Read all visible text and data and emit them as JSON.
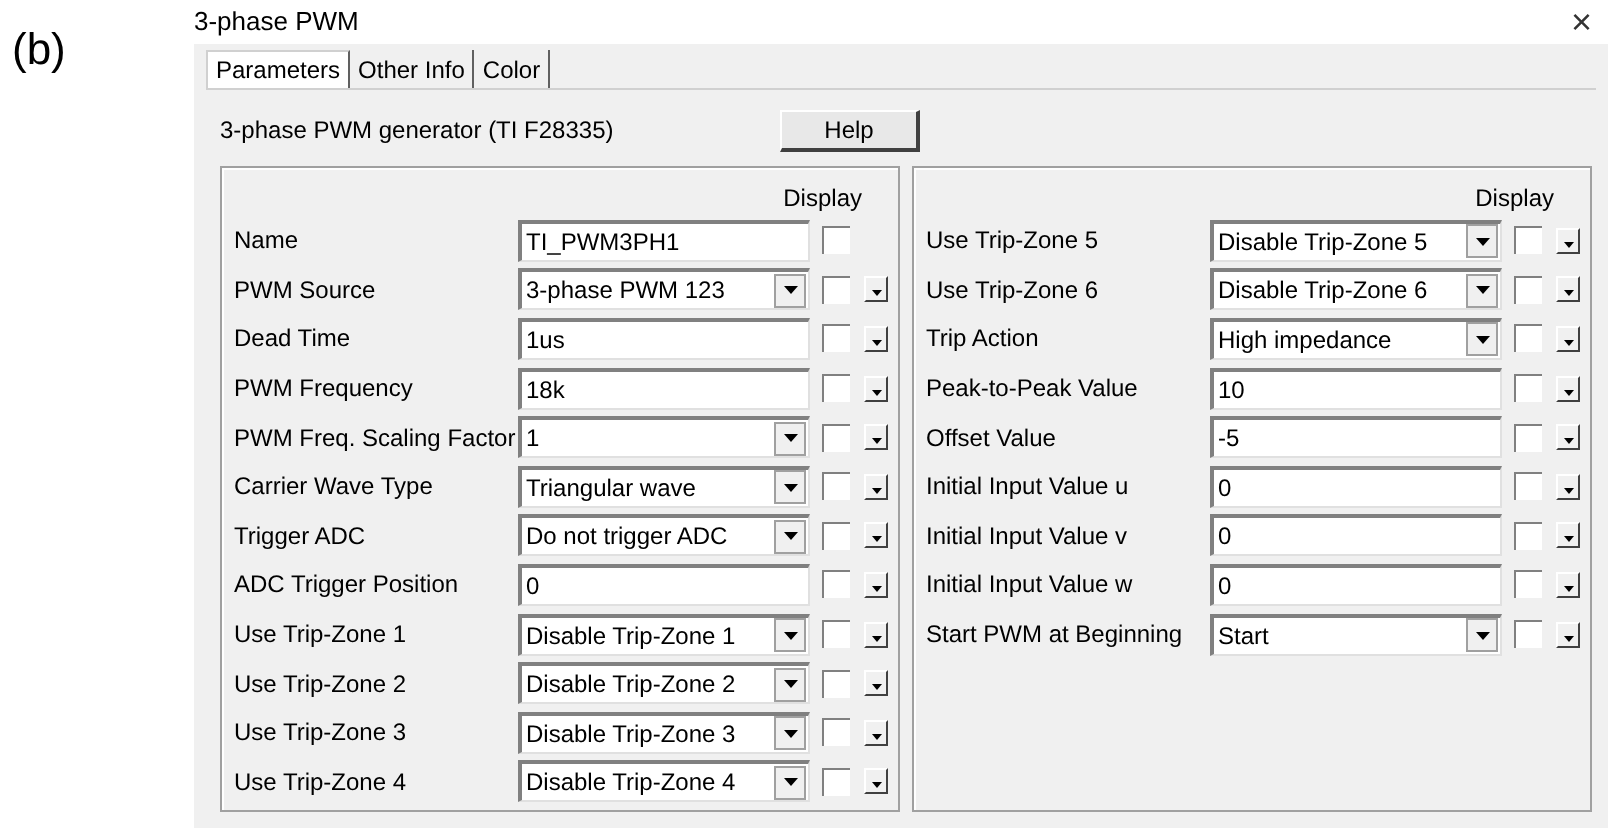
{
  "figure_label": "(b)",
  "window": {
    "title": "3-phase PWM",
    "close": "×"
  },
  "tabs": [
    {
      "label": "Parameters",
      "selected": true
    },
    {
      "label": "Other Info",
      "selected": false
    },
    {
      "label": "Color",
      "selected": false
    }
  ],
  "description": "3-phase PWM generator (TI F28335)",
  "help_button": "Help",
  "panels": [
    {
      "display_header": "Display",
      "rows": [
        {
          "label": "Name",
          "kind": "text",
          "value": "TI_PWM3PH1",
          "checked": false,
          "has_options_button": false
        },
        {
          "label": "PWM Source",
          "kind": "dropdown",
          "value": "3-phase PWM 123",
          "checked": false,
          "has_options_button": true
        },
        {
          "label": "Dead Time",
          "kind": "text",
          "value": "1us",
          "checked": false,
          "has_options_button": true
        },
        {
          "label": "PWM Frequency",
          "kind": "text",
          "value": "18k",
          "checked": false,
          "has_options_button": true
        },
        {
          "label": "PWM Freq. Scaling Factor",
          "kind": "dropdown",
          "value": "1",
          "checked": false,
          "has_options_button": true
        },
        {
          "label": "Carrier Wave Type",
          "kind": "dropdown",
          "value": "Triangular wave",
          "checked": false,
          "has_options_button": true
        },
        {
          "label": "Trigger ADC",
          "kind": "dropdown",
          "value": "Do not trigger ADC",
          "checked": false,
          "has_options_button": true
        },
        {
          "label": "ADC Trigger Position",
          "kind": "text",
          "value": "0",
          "checked": false,
          "has_options_button": true
        },
        {
          "label": "Use Trip-Zone 1",
          "kind": "dropdown",
          "value": "Disable Trip-Zone 1",
          "checked": false,
          "has_options_button": true
        },
        {
          "label": "Use Trip-Zone 2",
          "kind": "dropdown",
          "value": "Disable Trip-Zone 2",
          "checked": false,
          "has_options_button": true
        },
        {
          "label": "Use Trip-Zone 3",
          "kind": "dropdown",
          "value": "Disable Trip-Zone 3",
          "checked": false,
          "has_options_button": true
        },
        {
          "label": "Use Trip-Zone 4",
          "kind": "dropdown",
          "value": "Disable Trip-Zone 4",
          "checked": false,
          "has_options_button": true
        }
      ]
    },
    {
      "display_header": "Display",
      "rows": [
        {
          "label": "Use Trip-Zone 5",
          "kind": "dropdown",
          "value": "Disable Trip-Zone 5",
          "checked": false,
          "has_options_button": true
        },
        {
          "label": "Use Trip-Zone 6",
          "kind": "dropdown",
          "value": "Disable Trip-Zone 6",
          "checked": false,
          "has_options_button": true
        },
        {
          "label": "Trip Action",
          "kind": "dropdown",
          "value": "High impedance",
          "checked": false,
          "has_options_button": true
        },
        {
          "label": "Peak-to-Peak Value",
          "kind": "text",
          "value": "10",
          "checked": false,
          "has_options_button": true
        },
        {
          "label": "Offset Value",
          "kind": "text",
          "value": "-5",
          "checked": false,
          "has_options_button": true
        },
        {
          "label": "Initial Input Value u",
          "kind": "text",
          "value": "0",
          "checked": false,
          "has_options_button": true
        },
        {
          "label": "Initial Input Value v",
          "kind": "text",
          "value": "0",
          "checked": false,
          "has_options_button": true
        },
        {
          "label": "Initial Input Value w",
          "kind": "text",
          "value": "0",
          "checked": false,
          "has_options_button": true
        },
        {
          "label": "Start PWM at Beginning",
          "kind": "dropdown",
          "value": "Start",
          "checked": false,
          "has_options_button": true
        }
      ]
    }
  ]
}
